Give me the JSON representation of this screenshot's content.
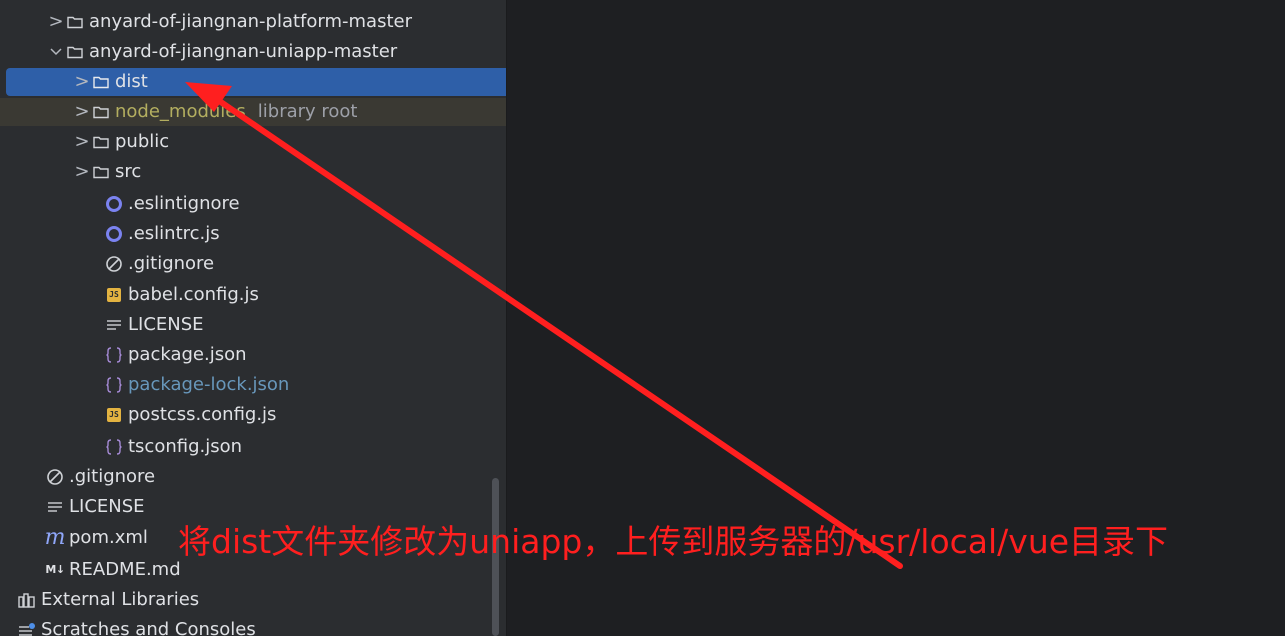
{
  "project_tree": {
    "items": [
      {
        "label": "anyard-of-jiangnan-platform-master",
        "chevron": ">",
        "icon": "folder-icon"
      },
      {
        "label": "anyard-of-jiangnan-uniapp-master",
        "chevron": "⌄",
        "icon": "folder-icon"
      },
      {
        "label": "dist",
        "chevron": ">",
        "icon": "folder-icon",
        "selected": true
      },
      {
        "label": "node_modules",
        "hint": "library root",
        "chevron": ">",
        "icon": "folder-icon"
      },
      {
        "label": "public",
        "chevron": ">",
        "icon": "folder-icon"
      },
      {
        "label": "src",
        "chevron": ">",
        "icon": "folder-icon"
      },
      {
        "label": ".eslintignore",
        "icon": "eslint-icon"
      },
      {
        "label": ".eslintrc.js",
        "icon": "eslint-icon"
      },
      {
        "label": ".gitignore",
        "icon": "ignore-icon"
      },
      {
        "label": "babel.config.js",
        "icon": "js-file-icon",
        "badge": "JS"
      },
      {
        "label": "LICENSE",
        "icon": "text-file-icon"
      },
      {
        "label": "package.json",
        "icon": "json-file-icon"
      },
      {
        "label": "package-lock.json",
        "icon": "json-file-icon"
      },
      {
        "label": "postcss.config.js",
        "icon": "js-file-icon",
        "badge": "JS"
      },
      {
        "label": "tsconfig.json",
        "icon": "json-file-icon"
      },
      {
        "label": ".gitignore",
        "icon": "ignore-icon"
      },
      {
        "label": "LICENSE",
        "icon": "text-file-icon"
      },
      {
        "label": "pom.xml",
        "icon": "maven-icon",
        "badge": "m"
      },
      {
        "label": "README.md",
        "icon": "markdown-icon",
        "badge": "M↓"
      },
      {
        "label": "External Libraries",
        "icon": "library-icon"
      },
      {
        "label": "Scratches and Consoles",
        "icon": "scratches-icon"
      }
    ]
  },
  "annotation": {
    "text": "将dist文件夹修改为uniapp，上传到服务器的/usr/local/vue目录下",
    "color": "#ff1f1f"
  },
  "colors": {
    "panel_bg": "#2b2d30",
    "editor_bg": "#1e1f22",
    "selection": "#2e5fa8",
    "library_text": "#b3ae60",
    "modified_text": "#6897bb"
  }
}
